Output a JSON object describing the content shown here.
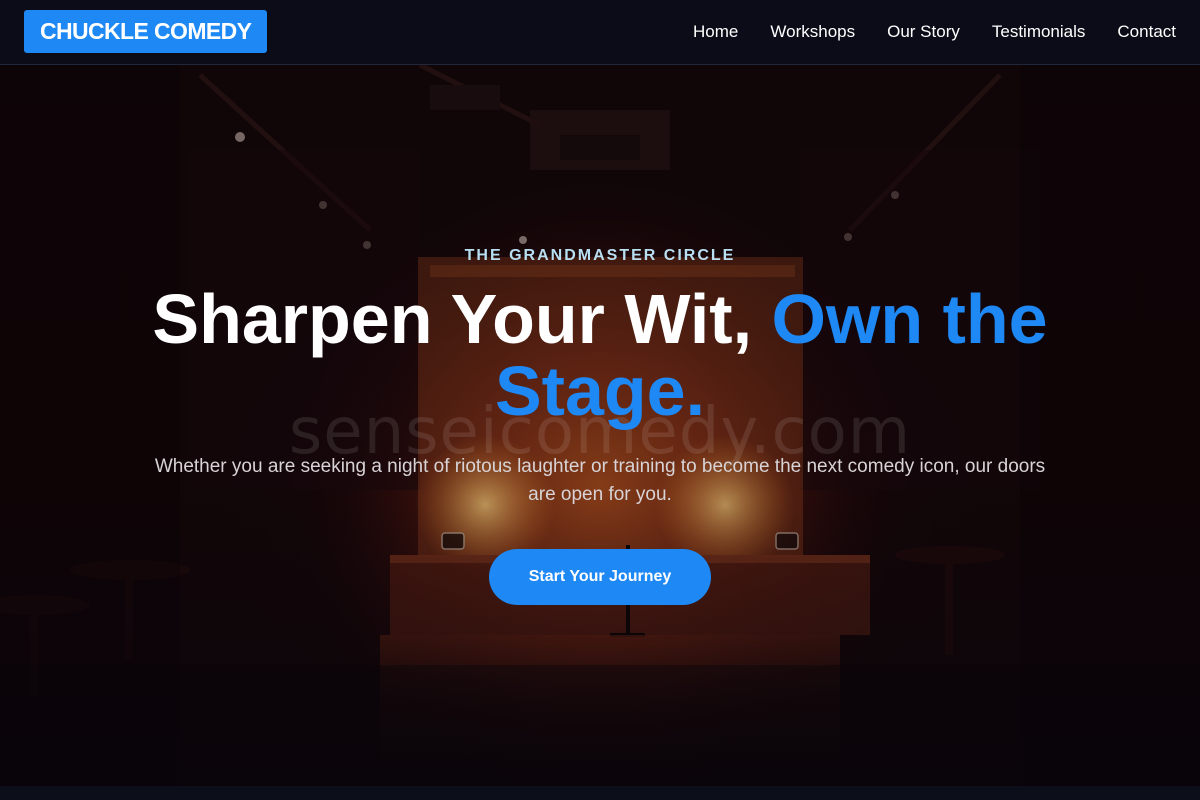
{
  "brand": {
    "logo_text": "CHUCKLE COMEDY",
    "accent_color": "#1e88f5"
  },
  "nav": {
    "items": [
      {
        "label": "Home"
      },
      {
        "label": "Workshops"
      },
      {
        "label": "Our Story"
      },
      {
        "label": "Testimonials"
      },
      {
        "label": "Contact"
      }
    ]
  },
  "hero": {
    "eyebrow": "THE GRANDMASTER CIRCLE",
    "headline_plain": "Sharpen Your Wit, ",
    "headline_accent": "Own the Stage.",
    "subtext": "Whether you are seeking a night of riotous laughter or training to become the next comedy icon, our doors are open for you.",
    "cta_label": "Start Your Journey",
    "watermark": "senseicomedy.com",
    "background_image": "dim comedy club stage with red-orange spotlight glow"
  }
}
